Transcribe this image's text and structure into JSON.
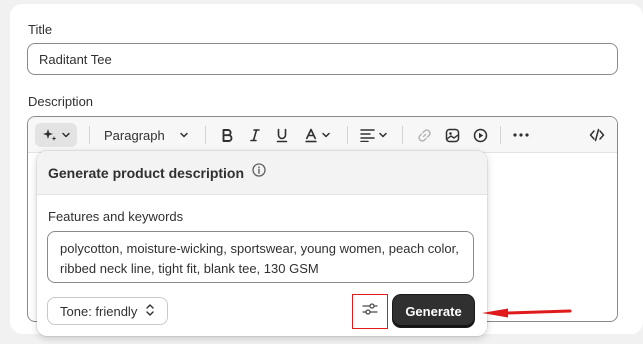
{
  "form": {
    "title_label": "Title",
    "title_value": "Raditant Tee",
    "description_label": "Description"
  },
  "toolbar": {
    "paragraph_label": "Paragraph",
    "icons": [
      "magic-sparkle-icon",
      "chevron-down-icon",
      "bold-icon",
      "italic-icon",
      "underline-icon",
      "text-color-icon",
      "align-icon",
      "link-icon",
      "image-icon",
      "video-icon",
      "more-icon",
      "code-icon"
    ]
  },
  "popover": {
    "title": "Generate product description",
    "keywords_label": "Features and keywords",
    "keywords_value": "polycotton, moisture-wicking, sportswear, young women, peach color, ribbed neck line, tight fit, blank tee, 130 GSM",
    "tone_label": "Tone: friendly",
    "generate_label": "Generate"
  },
  "colors": {
    "annotation_red": "#e01b1b",
    "primary_button": "#303030"
  }
}
